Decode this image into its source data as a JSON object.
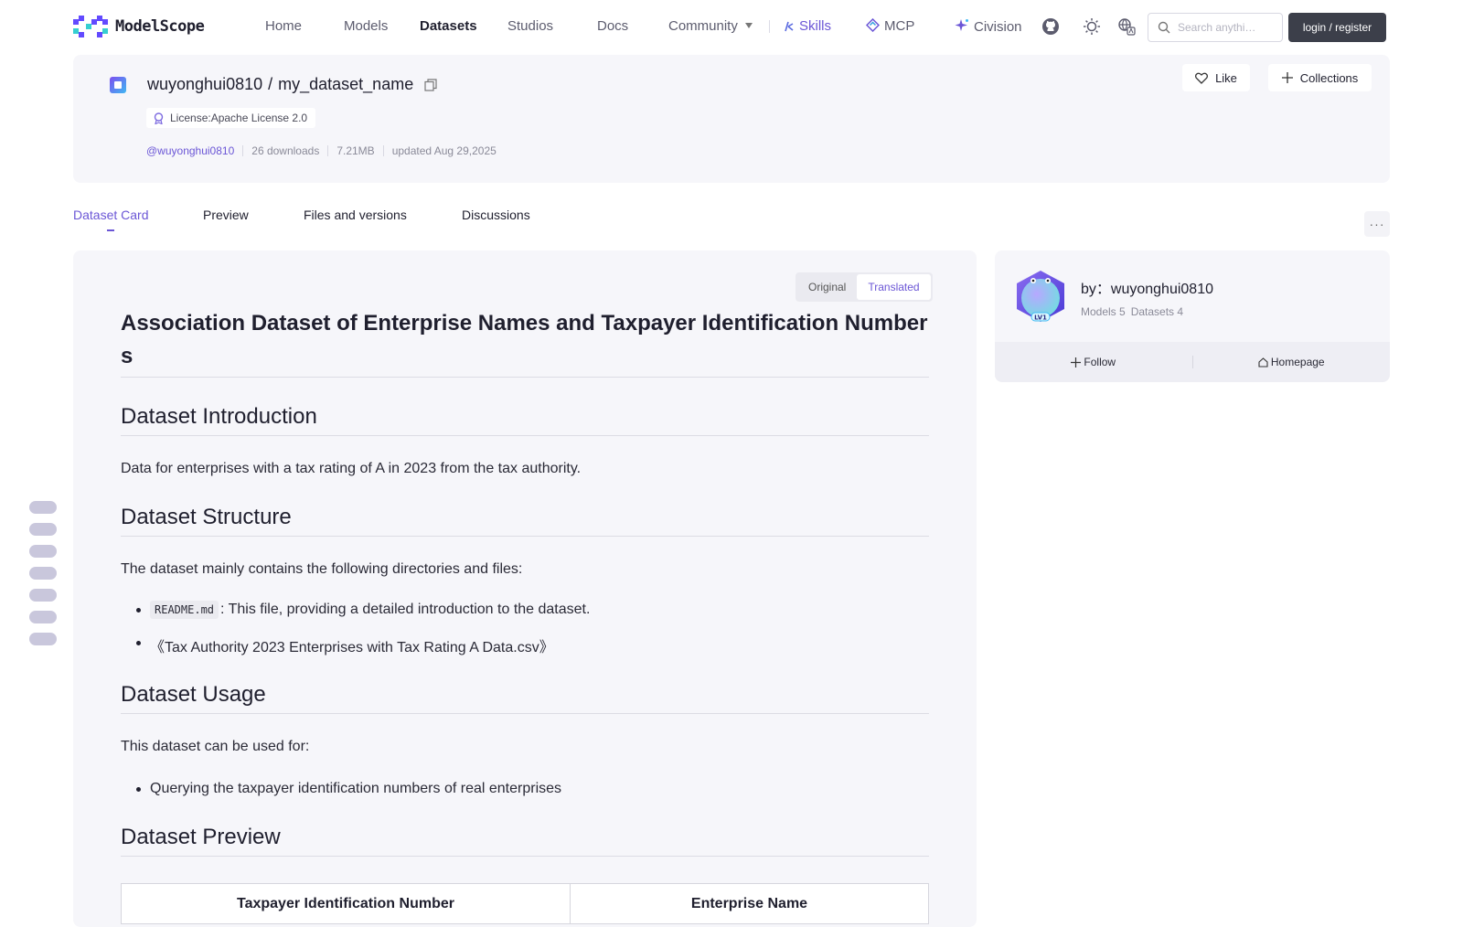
{
  "nav": {
    "logo_text": "ModelScope",
    "items": [
      "Home",
      "Models",
      "Datasets",
      "Studios",
      "Docs"
    ],
    "community": "Community",
    "skills": "Skills",
    "mcp": "MCP",
    "civision": "Civision",
    "search_placeholder": "Search anythi…",
    "login": "login / register"
  },
  "dataset": {
    "owner": "wuyonghui0810",
    "name": "my_dataset_name",
    "license": "License:Apache License 2.0",
    "owner_handle": "@wuyonghui0810",
    "downloads": "26 downloads",
    "size": "7.21MB",
    "updated": "updated Aug 29,2025",
    "like": "Like",
    "collections": "Collections"
  },
  "tabs": [
    "Dataset Card",
    "Preview",
    "Files and versions",
    "Discussions"
  ],
  "toggle": {
    "original": "Original",
    "translated": "Translated"
  },
  "card": {
    "title_line1": "Association Dataset of Enterprise Names and Taxpayer Identification Number",
    "title_line2": "s",
    "intro_heading": "Dataset Introduction",
    "intro_text": "Data for enterprises with a tax rating of A in 2023 from the tax authority.",
    "structure_heading": "Dataset Structure",
    "structure_text": "The dataset mainly contains the following directories and files:",
    "file1_code": "README.md",
    "file1_text": ": This file, providing a detailed introduction to the dataset.",
    "file2": "《Tax Authority 2023 Enterprises with Tax Rating A Data.csv》",
    "usage_heading": "Dataset Usage",
    "usage_text": "This dataset can be used for:",
    "usage_item": "Querying the taxpayer identification numbers of real enterprises",
    "preview_heading": "Dataset Preview",
    "table_headers": [
      "Taxpayer Identification Number",
      "Enterprise Name"
    ]
  },
  "author": {
    "by": "by：wuyonghui0810",
    "level": "LV1",
    "models": "Models 5",
    "datasets": "Datasets 4",
    "follow": "Follow",
    "homepage": "Homepage"
  },
  "colors": {
    "accent": "#6b56d6",
    "panel": "#f6f6fa",
    "button_dark": "#3c3f4a"
  }
}
